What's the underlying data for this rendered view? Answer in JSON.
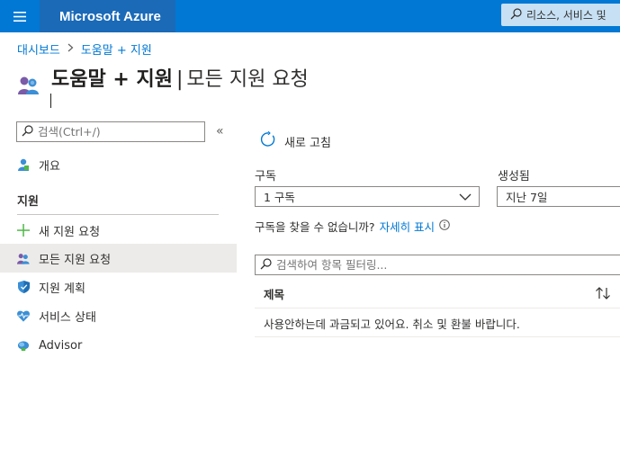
{
  "header": {
    "brand": "Microsoft Azure",
    "search_placeholder": "리소스, 서비스 및",
    "color": "#0078d4"
  },
  "breadcrumb": [
    "대시보드",
    "도움말 + 지원"
  ],
  "page": {
    "title_main": "도움말 + 지원",
    "title_sub": "모든 지원 요청"
  },
  "sidebar": {
    "search_placeholder": "검색(Ctrl+/)",
    "collapse": "«",
    "overview": "개요",
    "section": "지원",
    "items": [
      {
        "label": "새 지원 요청",
        "icon": "plus-icon"
      },
      {
        "label": "모든 지원 요청",
        "icon": "people-icon",
        "selected": true
      },
      {
        "label": "지원 계획",
        "icon": "shield-icon"
      },
      {
        "label": "서비스 상태",
        "icon": "heartbeat-icon"
      },
      {
        "label": "Advisor",
        "icon": "advisor-icon"
      }
    ]
  },
  "toolbar": {
    "refresh": "새로 고침"
  },
  "filters": {
    "subscription_label": "구독",
    "subscription_value": "1 구독",
    "created_label": "생성됨",
    "created_value": "지난 7일"
  },
  "notice": {
    "text": "구독을 찾을 수 없습니까?",
    "link": "자세히 표시"
  },
  "table": {
    "filter_placeholder": "검색하여 항목 필터링...",
    "column": "제목",
    "rows": [
      "사용안하는데 과금되고 있어요. 취소 및 환불 바랍니다."
    ]
  }
}
